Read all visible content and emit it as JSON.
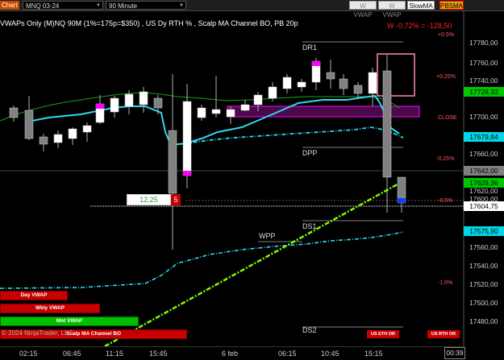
{
  "toolbar": {
    "chart_label": "Chart",
    "instrument": "MNQ 03-24",
    "interval": "90 Minute",
    "buttons": [
      "W VWAP",
      "W VWAP",
      "SlowMA",
      "PBSMA"
    ]
  },
  "title": "VWAPs Only (M)NQ 90M  (1%=175p=$350) , US Dy RTH % , Scalp MA Channel BO, PB 20p",
  "pnl": "W -0,72% = -128,50",
  "pct_labels": [
    "+0.5%",
    "+0.25%",
    "CLOSE",
    "-0.25%",
    "-0.5%",
    "-1.0%"
  ],
  "level_labels": {
    "dr1": "DR1",
    "dpp": "DPP",
    "ds1": "DS1",
    "wpp": "WPP",
    "ds2": "DS2"
  },
  "price_axis": [
    "17780,00",
    "17760,00",
    "17740,00",
    "17700,00",
    "17660,00",
    "17620,00",
    "17600,00",
    "17560,00",
    "17540,00",
    "17520,00",
    "17500,00",
    "17480,00"
  ],
  "price_badges": [
    {
      "label": "17728,33",
      "bg": "#00c800",
      "fg": "#000000"
    },
    {
      "label": "17679,84",
      "bg": "#00d8e8",
      "fg": "#000000"
    },
    {
      "label": "17642,00",
      "bg": "#808080",
      "fg": "#000000"
    },
    {
      "label": "17629,36",
      "bg": "#00c800",
      "fg": "#000000"
    },
    {
      "label": "17604,75",
      "bg": "#ffffff",
      "fg": "#000000"
    },
    {
      "label": "17575,90",
      "bg": "#00d8e8",
      "fg": "#000000"
    }
  ],
  "time_axis": [
    "02:15",
    "06:45",
    "11:15",
    "15:45",
    "6 feb",
    "06:15",
    "10:45",
    "15:15"
  ],
  "clock": "00:39",
  "counter": {
    "value": "12,25",
    "count": "5"
  },
  "vwap_bars": {
    "day": "Day VWAP",
    "wkly": "Wkly VWAP",
    "mnt": "Mnt VWAP",
    "scalp": "Scalp MA Channel BO"
  },
  "copyright": "© 2024 NinjaTrader, LLC",
  "eth_buttons": [
    "US ETH OR",
    "US RTH OR"
  ],
  "colors": {
    "up": "#ffffff",
    "down": "#808080",
    "wick": "#b0b0b0",
    "magenta": "#ff00ff",
    "cyan": "#30d8ee",
    "green_ma": "#1aa01a",
    "lime": "#7cfc00",
    "zone": "#ff00ff"
  }
}
